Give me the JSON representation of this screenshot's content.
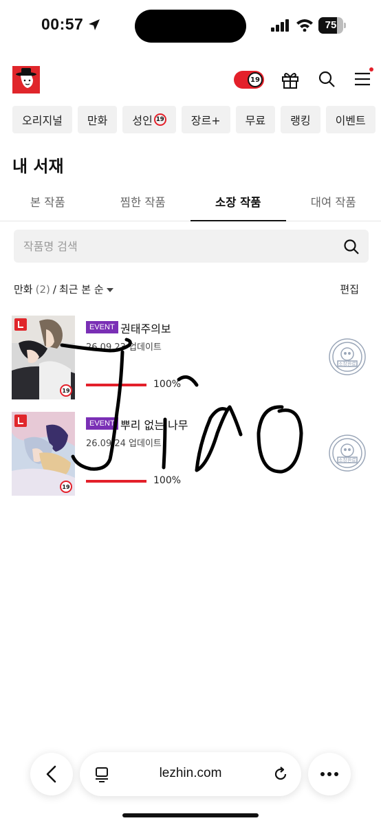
{
  "status_bar": {
    "time": "00:57",
    "battery": "75",
    "battery_level": 0.75
  },
  "header": {
    "adult_badge": "19",
    "icons": [
      "logo-icon",
      "adult-toggle-icon",
      "gift-icon",
      "search-icon",
      "menu-icon"
    ]
  },
  "categories": [
    {
      "label": "오리지널"
    },
    {
      "label": "만화"
    },
    {
      "label": "성인",
      "badge": "19"
    },
    {
      "label": "장르+"
    },
    {
      "label": "무료"
    },
    {
      "label": "랭킹"
    },
    {
      "label": "이벤트"
    }
  ],
  "page": {
    "title": "내 서재"
  },
  "tabs": [
    {
      "label": "본 작품",
      "active": false
    },
    {
      "label": "찜한 작품",
      "active": false
    },
    {
      "label": "소장 작품",
      "active": true
    },
    {
      "label": "대여 작품",
      "active": false
    }
  ],
  "search": {
    "placeholder": "작품명 검색"
  },
  "filter": {
    "category": "만화",
    "count": "(2)",
    "separator": "/",
    "sort": "최근 본 순",
    "edit": "편집"
  },
  "items": [
    {
      "event": "EVENT",
      "title": "권태주의보",
      "date": "26.09.23 업데이트",
      "progress_text": "100%",
      "progress": 1.0,
      "badge": "19",
      "stamp": "소장완료"
    },
    {
      "event": "EVENT",
      "title": "뿌리 없는 나무",
      "date": "26.09.24 업데이트",
      "progress_text": "100%",
      "progress": 1.0,
      "badge": "19",
      "stamp": "소장완료"
    }
  ],
  "overlay": {
    "handwriting": "Jiao"
  },
  "browser": {
    "url": "lezhin.com"
  },
  "colors": {
    "brand_red": "#e3202a",
    "event_purple": "#7a2fb5",
    "chip_bg": "#f1f1f1"
  }
}
